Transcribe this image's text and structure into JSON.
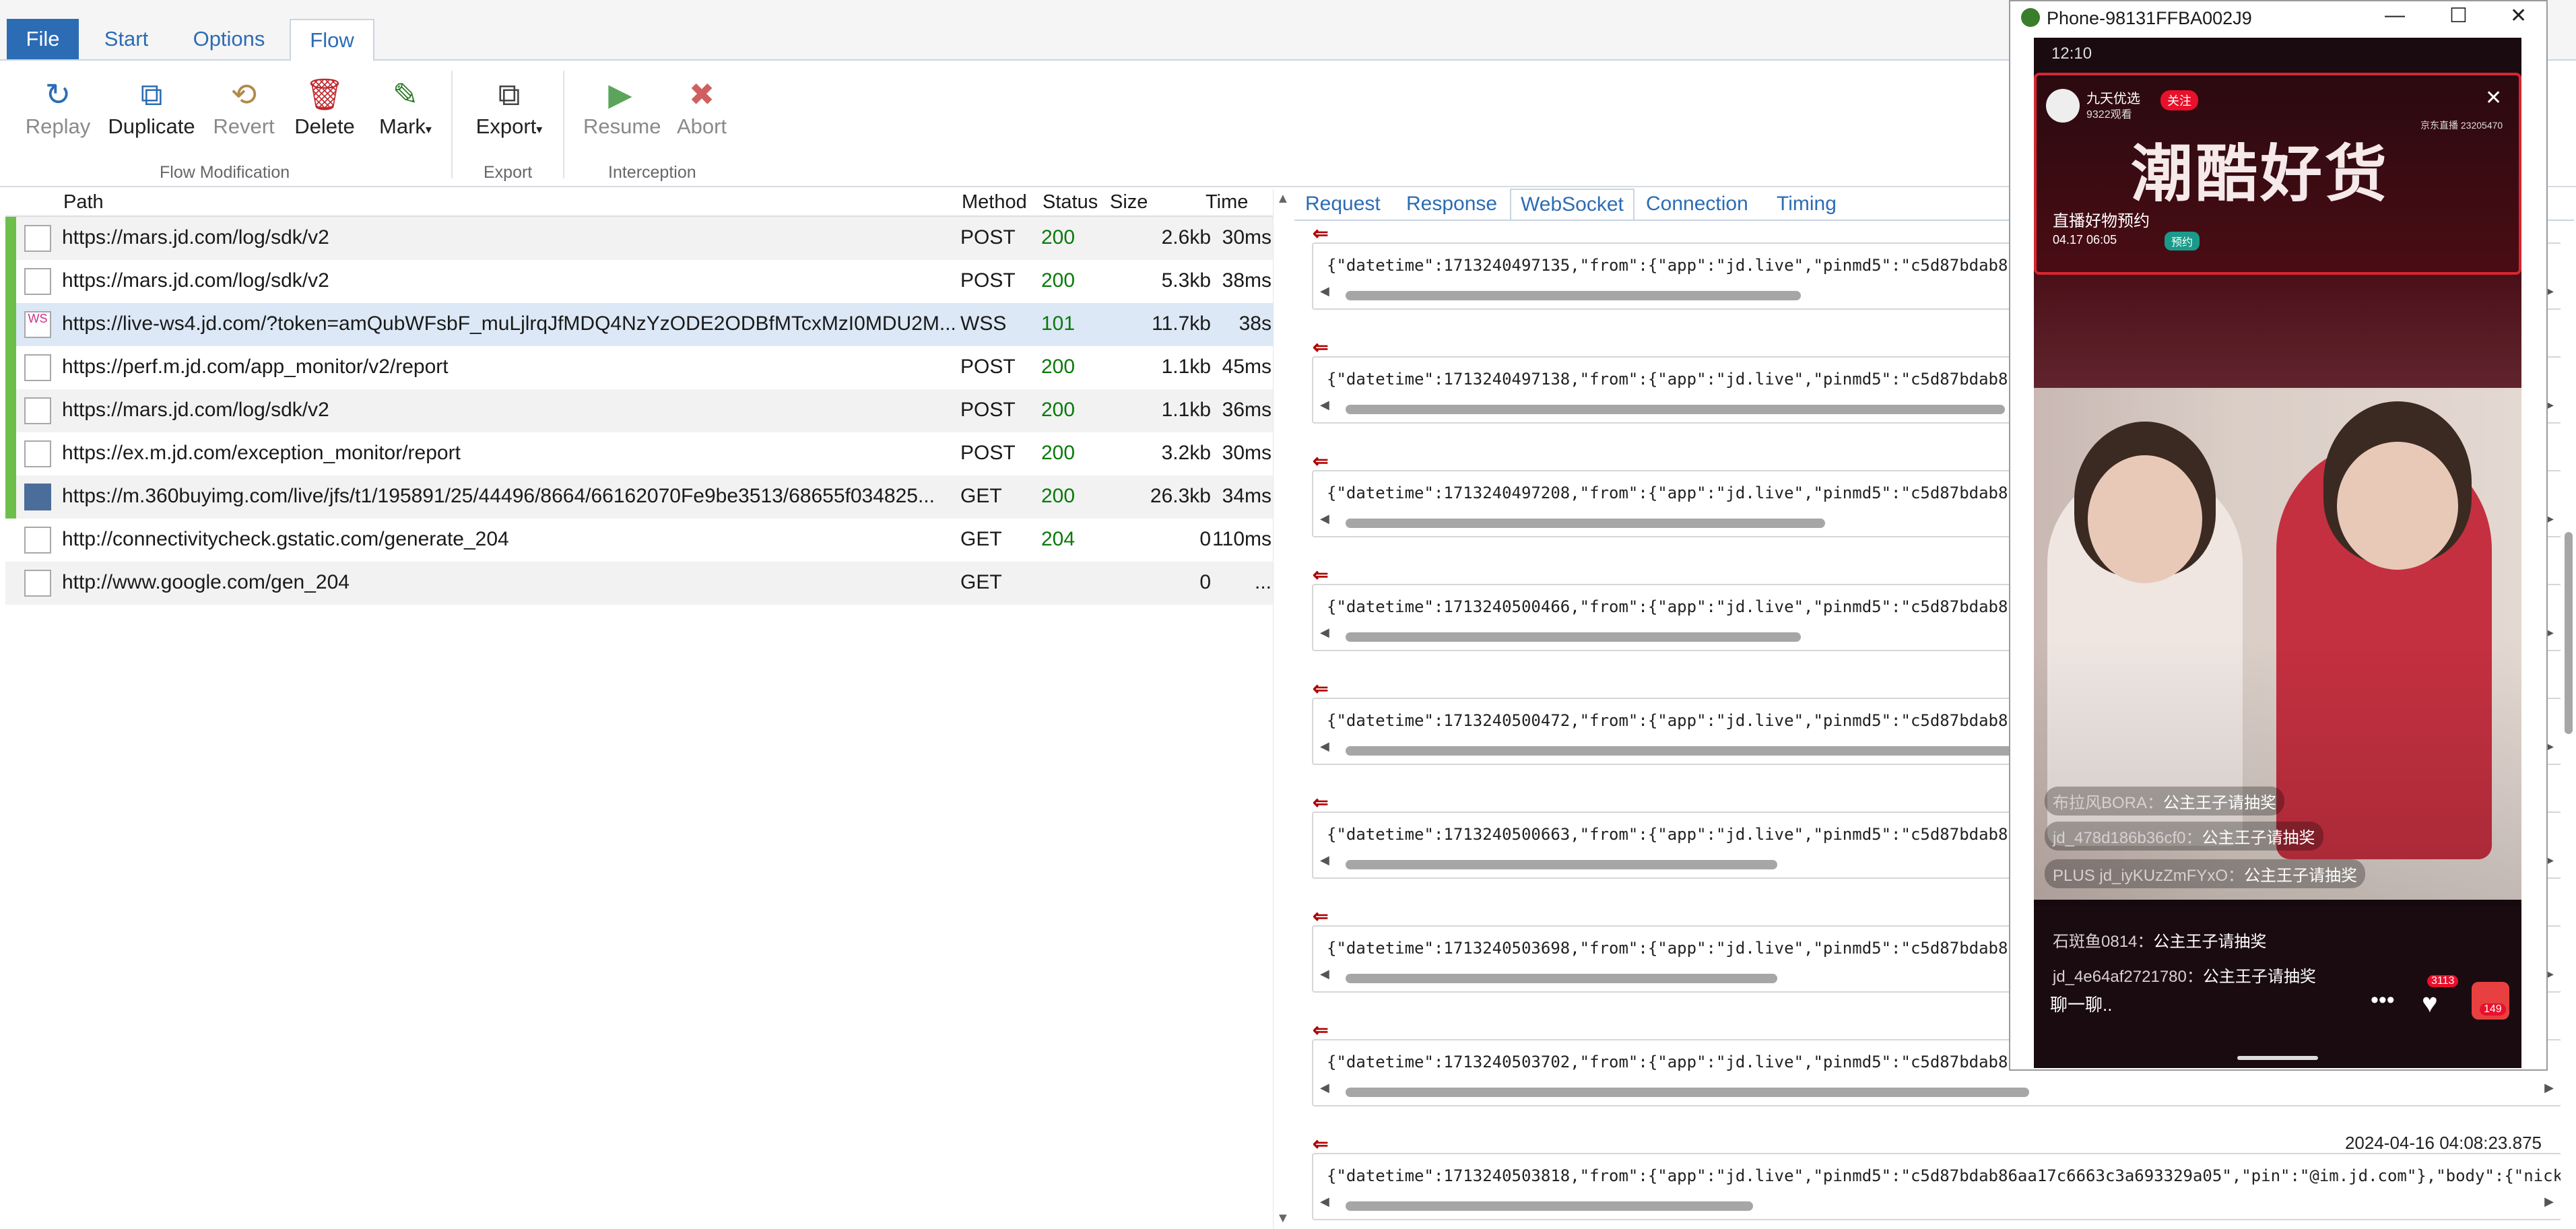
{
  "menu": {
    "file": "File",
    "start": "Start",
    "options": "Options",
    "flow": "Flow"
  },
  "ribbon": {
    "replay": "Replay",
    "duplicate": "Duplicate",
    "revert": "Revert",
    "delete": "Delete",
    "mark": "Mark",
    "export": "Export",
    "resume": "Resume",
    "abort": "Abort",
    "group_flow": "Flow Modification",
    "group_export": "Export",
    "group_interception": "Interception",
    "dropdown_glyph": "▾"
  },
  "list": {
    "headers": {
      "path": "Path",
      "method": "Method",
      "status": "Status",
      "size": "Size",
      "time": "Time"
    },
    "rows": [
      {
        "path": "https://mars.jd.com/log/sdk/v2",
        "method": "POST",
        "status": "200",
        "size": "2.6kb",
        "time": "30ms"
      },
      {
        "path": "https://mars.jd.com/log/sdk/v2",
        "method": "POST",
        "status": "200",
        "size": "5.3kb",
        "time": "38ms"
      },
      {
        "path": "https://live-ws4.jd.com/?token=amQubWFsbF_muLjlrqJfMDQ4NzYzODE2ODBfMTcxMzI0MDU2M...",
        "method": "WSS",
        "status": "101",
        "size": "11.7kb",
        "time": "38s"
      },
      {
        "path": "https://perf.m.jd.com/app_monitor/v2/report",
        "method": "POST",
        "status": "200",
        "size": "1.1kb",
        "time": "45ms"
      },
      {
        "path": "https://mars.jd.com/log/sdk/v2",
        "method": "POST",
        "status": "200",
        "size": "1.1kb",
        "time": "36ms"
      },
      {
        "path": "https://ex.m.jd.com/exception_monitor/report",
        "method": "POST",
        "status": "200",
        "size": "3.2kb",
        "time": "30ms"
      },
      {
        "path": "https://m.360buyimg.com/live/jfs/t1/195891/25/44496/8664/66162070Fe9be3513/68655f034825...",
        "method": "GET",
        "status": "200",
        "size": "26.3kb",
        "time": "34ms"
      },
      {
        "path": "http://connectivitycheck.gstatic.com/generate_204",
        "method": "GET",
        "status": "204",
        "size": "0",
        "time": "110ms"
      },
      {
        "path": "http://www.google.com/gen_204",
        "method": "GET",
        "status": "",
        "size": "0",
        "time": "..."
      }
    ],
    "ws_icon_text": "WS"
  },
  "detail": {
    "tabs": [
      "Request",
      "Response",
      "WebSocket",
      "Connection",
      "Timing"
    ],
    "messages": [
      {
        "code": "{\"datetime\":1713240497135,\"from\":{\"app\":\"jd.live\",\"pinmd5\":\"c5d87bdab86",
        "ts": "",
        "scroll": 0.38
      },
      {
        "code": "{\"datetime\":1713240497138,\"from\":{\"app\":\"jd.live\",\"pinmd5\":\"c5d87bdab86",
        "ts": "",
        "scroll": 0.55
      },
      {
        "code": "{\"datetime\":1713240497208,\"from\":{\"app\":\"jd.live\",\"pinmd5\":\"c5d87bdab86",
        "ts": "",
        "scroll": 0.4
      },
      {
        "code": "{\"datetime\":1713240500466,\"from\":{\"app\":\"jd.live\",\"pinmd5\":\"c5d87bdab86",
        "ts": "",
        "scroll": 0.38
      },
      {
        "code": "{\"datetime\":1713240500472,\"from\":{\"app\":\"jd.live\",\"pinmd5\":\"c5d87bdab86",
        "ts": "",
        "scroll": 0.62
      },
      {
        "code": "{\"datetime\":1713240500663,\"from\":{\"app\":\"jd.live\",\"pinmd5\":\"c5d87bdab86",
        "ts": "",
        "scroll": 0.36
      },
      {
        "code": "{\"datetime\":1713240503698,\"from\":{\"app\":\"jd.live\",\"pinmd5\":\"c5d87bdab86",
        "ts": "",
        "scroll": 0.36
      },
      {
        "code": "{\"datetime\":1713240503702,\"from\":{\"app\":\"jd.live\",\"pinmd5\":\"c5d87bdab86",
        "ts": "",
        "scroll": 0.57
      },
      {
        "code": "{\"datetime\":1713240503818,\"from\":{\"app\":\"jd.live\",\"pinmd5\":\"c5d87bdab86aa17c6663c3a693329a05\",\"pin\":\"@im.jd.com\"},\"body\":{\"nick",
        "ts": "2024-04-16 04:08:23.875",
        "scroll": 0.34
      }
    ],
    "bottom_timestamp_partial": "2024-04-16 04:08:23.875"
  },
  "phone": {
    "title": "Phone-98131FFBA002J9",
    "status_time": "12:10",
    "shop_name": "九天优选",
    "viewers": "9322观看",
    "follow": "关注",
    "rank": "京东直播 23205470",
    "banner_title": "潮酷好货",
    "preview_title": "直播好物预约",
    "preview_time": "04.17 06:05",
    "preview_btn": "预约",
    "comments": [
      {
        "user": "布拉风BORA：",
        "text": "公主王子请抽奖"
      },
      {
        "user": "jd_478d186b36cf0：",
        "text": "公主王子请抽奖"
      },
      {
        "user": "PLUS jd_iyKUzZmFYxO：",
        "text": "公主王子请抽奖"
      },
      {
        "user": "石斑鱼0814：",
        "text": "公主王子请抽奖"
      },
      {
        "user": "jd_4e64af2721780：",
        "text": "公主王子请抽奖"
      }
    ],
    "chat_placeholder": "聊一聊..",
    "like_count": "3113",
    "gift_count": "149"
  }
}
